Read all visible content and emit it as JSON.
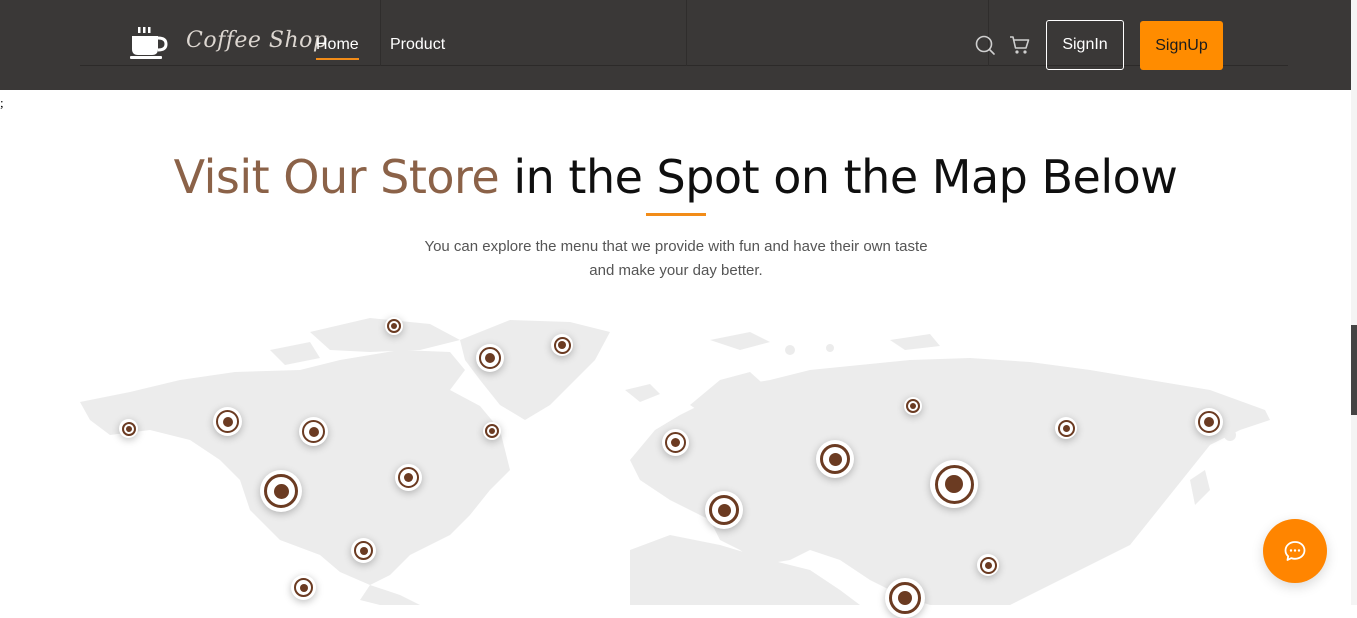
{
  "header": {
    "brand": "Coffee Shop",
    "nav": [
      {
        "label": "Home",
        "active": true
      },
      {
        "label": "Product",
        "active": false
      }
    ],
    "signin_label": "SignIn",
    "signup_label": "SignUp",
    "icons": [
      "coffee-cup-icon",
      "search-icon",
      "cart-icon"
    ]
  },
  "stray_text": ";",
  "hero": {
    "title_accent": "Visit Our Store",
    "title_rest": " in the Spot on the Map Below",
    "subtitle": "You can explore the menu that we provide with fun and have their own taste and make your day better."
  },
  "colors": {
    "nav_bg": "#3a3837",
    "accent_orange": "#ff8c00",
    "title_brown": "#8b6248",
    "pin_brown": "#6b3b22",
    "map_land": "#ececec"
  },
  "chat": {
    "icon": "chat-bubble-icon"
  }
}
